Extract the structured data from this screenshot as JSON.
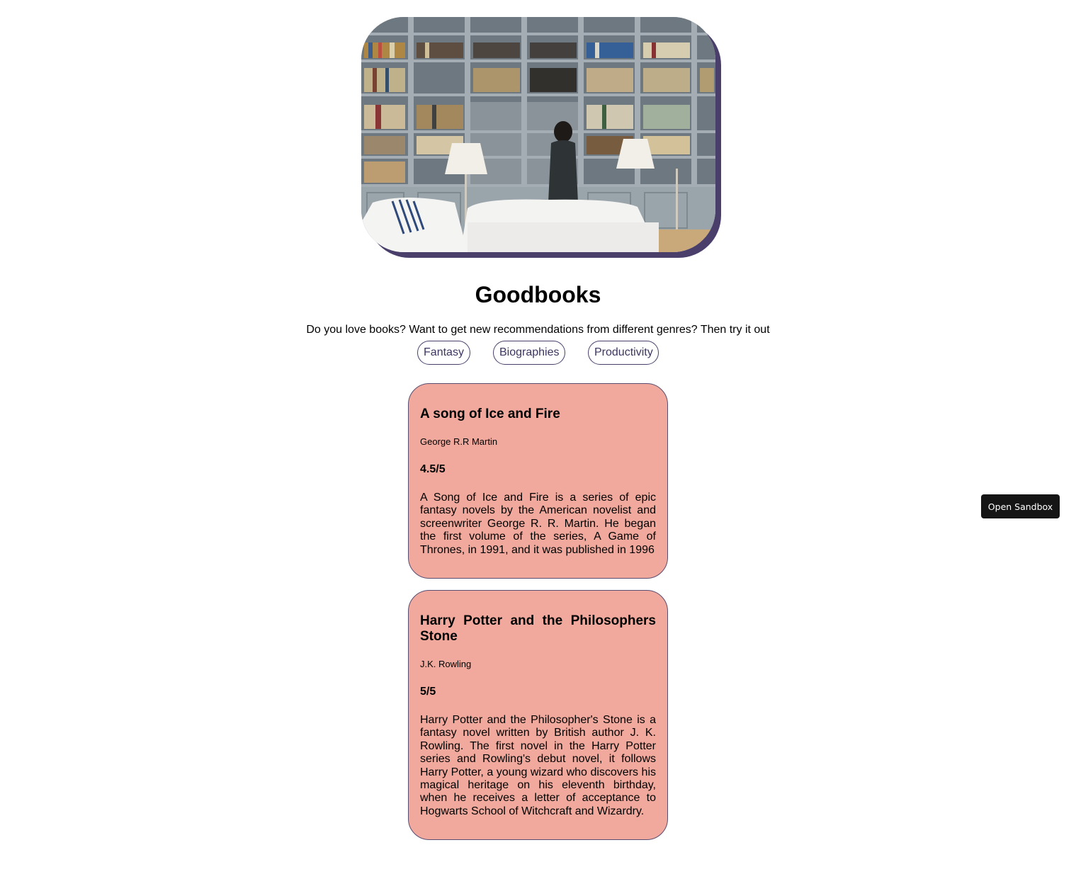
{
  "header": {
    "hero_image": "library-bookshelves-photo",
    "title": "Goodbooks",
    "tagline": "Do you love books? Want to get new recommendations from different genres? Then try it out"
  },
  "genres": [
    {
      "label": "Fantasy"
    },
    {
      "label": "Biographies"
    },
    {
      "label": "Productivity"
    }
  ],
  "books": [
    {
      "title": "A song of Ice and Fire",
      "author": "George R.R Martin",
      "rating": "4.5/5",
      "description": "A Song of Ice and Fire is a series of epic fantasy novels by the American novelist and screenwriter George R. R. Martin. He began the first volume of the series, A Game of Thrones, in 1991, and it was published in 1996"
    },
    {
      "title": "Harry Potter and the Philosophers Stone",
      "author": "J.K. Rowling",
      "rating": "5/5",
      "description": "Harry Potter and the Philosopher's Stone is a fantasy novel written by British author J. K. Rowling. The first novel in the Harry Potter series and Rowling's debut novel, it follows Harry Potter, a young wizard who discovers his magical heritage on his eleventh birthday, when he receives a letter of acceptance to Hogwarts School of Witchcraft and Wizardry."
    }
  ],
  "sandbox": {
    "label": "Open Sandbox"
  },
  "colors": {
    "card_bg": "#f0a99c",
    "accent": "#4a3f6b"
  }
}
